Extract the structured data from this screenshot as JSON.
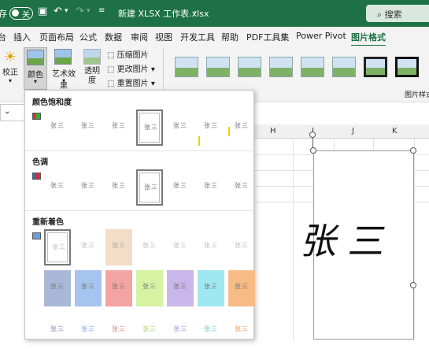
{
  "titlebar": {
    "autosave_partial": "存",
    "toggle_label": "关",
    "filename": "新建 XLSX 工作表.xlsx",
    "search": "搜索"
  },
  "tabs": [
    "台",
    "插入",
    "页面布局",
    "公式",
    "数据",
    "审阅",
    "视图",
    "开发工具",
    "帮助",
    "PDF工具集",
    "Power Pivot",
    "图片格式"
  ],
  "ribbon": {
    "correct": "校正",
    "color": "颜色",
    "artistic": "艺术效果",
    "transparency": "透明度",
    "compress": "压缩图片",
    "change": "更改图片",
    "reset": "重置图片",
    "styles_label": "图片样式"
  },
  "sheet": {
    "columns": [
      "H",
      "I",
      "J",
      "K"
    ],
    "signature": "张三"
  },
  "dropdown": {
    "sec_saturation": "颜色饱和度",
    "sec_tone": "色调",
    "sec_recolor": "重新着色",
    "thumb_text": "张三",
    "recolor_colors": [
      "#a9b8d8",
      "#a6c4f0",
      "#f4a3a3",
      "#d6f2a3",
      "#c9b6ea",
      "#9fe8f2",
      "#f7bb86"
    ],
    "accent": "#1e7145"
  }
}
